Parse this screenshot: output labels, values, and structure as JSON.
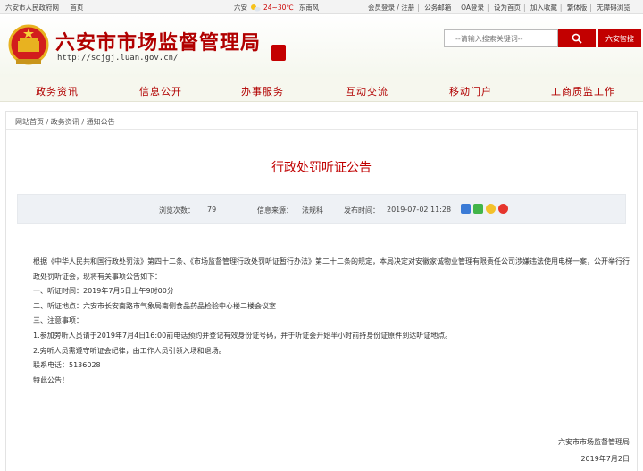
{
  "topbar": {
    "gov_link": "六安市人民政府网",
    "home_link": "首页",
    "city": "六安",
    "temperature": "24~30℃",
    "wind": "东南风",
    "links": [
      "会员登录 / 注册",
      "公务邮箱",
      "OA登录",
      "设为首页",
      "加入收藏",
      "繁体版",
      "无障碍浏览"
    ]
  },
  "header": {
    "site_title": "六安市市场监督管理局",
    "site_url": "http://scjgj.luan.gov.cn/",
    "search_placeholder": "--请输入搜索关键词--",
    "smart_search_label": "六安智搜"
  },
  "nav": {
    "items": [
      "政务资讯",
      "信息公开",
      "办事服务",
      "互动交流",
      "移动门户",
      "工商质监工作"
    ]
  },
  "breadcrumb": {
    "items": [
      "网站首页",
      "政务资讯",
      "通知公告"
    ],
    "separator": "/"
  },
  "article": {
    "title": "行政处罚听证公告",
    "views_label": "浏览次数：",
    "views": "79",
    "source_label": "信息来源：",
    "source": "法规科",
    "published_label": "发布时间：",
    "published": "2019-07-02 11:28",
    "paragraphs": [
      "根据《中华人民共和国行政处罚法》第四十二条、《市场监督管理行政处罚听证暂行办法》第二十二条的规定，本局决定对安徽家诚物业管理有限责任公司涉嫌违法使用电梯一案，公开举行行政处罚听证会，现将有关事项公告如下：",
      "一、听证时间：2019年7月5日上午9时00分",
      "二、听证地点：六安市长安南路市气象局南侧食品药品检验中心楼二楼会议室",
      "三、注意事项：",
      "1.参加旁听人员请于2019年7月4日16:00前电话预约并登记有效身份证号码，并于听证会开始半小时前持身份证原件到达听证地点。",
      "2.旁听人员需遵守听证会纪律，由工作人员引领入场和退场。",
      "联系电话：5136028",
      "特此公告！"
    ],
    "signature_org": "六安市市场监督管理局",
    "signature_date": "2019年7月2日"
  },
  "colors": {
    "brand_red": "#b10000",
    "meta_bg": "#eef1f5"
  }
}
